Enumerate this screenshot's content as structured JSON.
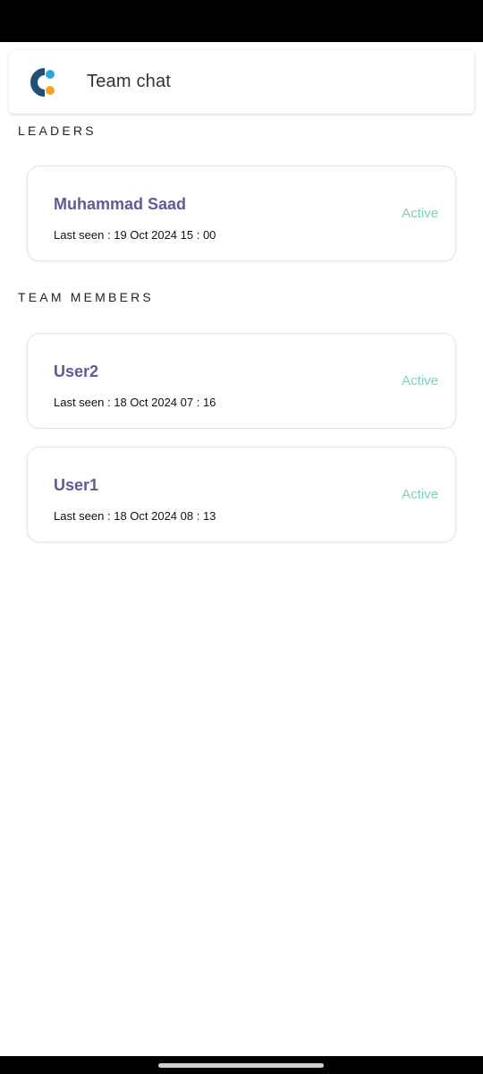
{
  "header": {
    "title": "Team chat"
  },
  "sections": {
    "leaders": {
      "title": "LEADERS",
      "members": [
        {
          "name": "Muhammad Saad",
          "last_seen": "Last seen : 19 Oct 2024 15 : 00",
          "status": "Active"
        }
      ]
    },
    "team_members": {
      "title": "TEAM MEMBERS",
      "members": [
        {
          "name": "User2",
          "last_seen": "Last seen : 18 Oct 2024 07 : 16",
          "status": "Active"
        },
        {
          "name": "User1",
          "last_seen": "Last seen : 18 Oct 2024 08 : 13",
          "status": "Active"
        }
      ]
    }
  },
  "colors": {
    "name": "#5f5b96",
    "status_active": "#7fcfc1",
    "logo_dark": "#1f4e78",
    "logo_blue": "#29a8e0",
    "logo_orange": "#f5a623"
  },
  "icons": {
    "logo": "app-logo-icon"
  }
}
